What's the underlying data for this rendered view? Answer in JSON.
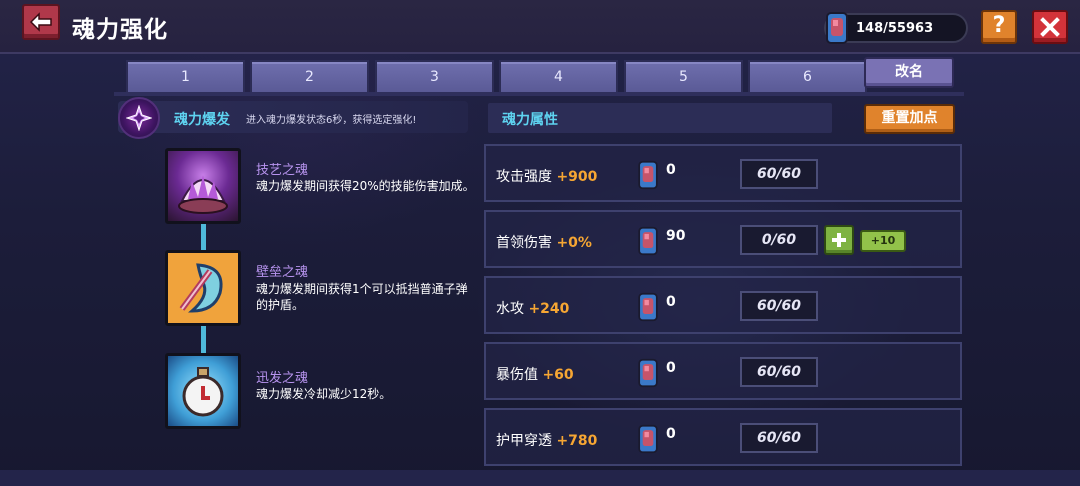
{
  "header": {
    "title": "魂力强化",
    "currency": "148/55963"
  },
  "tabs": [
    "1",
    "2",
    "3",
    "4",
    "5",
    "6"
  ],
  "rename_label": "改名",
  "burst": {
    "title": "魂力爆发",
    "desc": "进入魂力爆发状态6秒，获得选定强化!"
  },
  "skills": [
    {
      "name": "技艺之魂",
      "desc": "魂力爆发期间获得20%的技能伤害加成。"
    },
    {
      "name": "壁垒之魂",
      "desc": "魂力爆发期间获得1个可以抵挡普通子弹的护盾。"
    },
    {
      "name": "迅发之魂",
      "desc": "魂力爆发冷却减少12秒。"
    }
  ],
  "attributes": {
    "title": "魂力属性",
    "reset_label": "重置加点",
    "rows": [
      {
        "label": "攻击强度",
        "bonus": "+900",
        "count": "0",
        "progress": "60/60"
      },
      {
        "label": "首领伤害",
        "bonus": "+0%",
        "count": "90",
        "progress": "0/60",
        "plus10": "+10"
      },
      {
        "label": "水攻",
        "bonus": "+240",
        "count": "0",
        "progress": "60/60"
      },
      {
        "label": "暴伤值",
        "bonus": "+60",
        "count": "0",
        "progress": "60/60"
      },
      {
        "label": "护甲穿透",
        "bonus": "+780",
        "count": "0",
        "progress": "60/60"
      }
    ]
  },
  "colors": {
    "accent_cyan": "#5ed3f0",
    "bonus_orange": "#f6a633",
    "skill_name_purple": "#b894ef"
  },
  "icons": [
    "back-arrow-icon",
    "soul-gem-icon",
    "help-icon",
    "close-icon",
    "soul-burst-icon",
    "plus-icon"
  ]
}
